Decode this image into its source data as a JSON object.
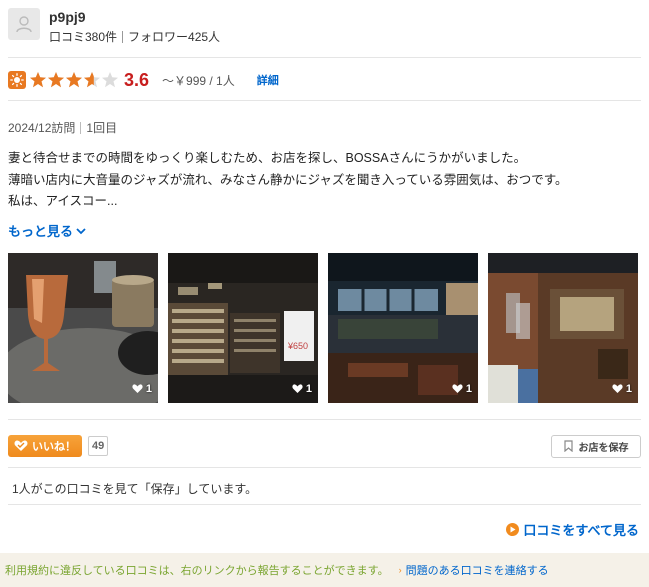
{
  "user": {
    "name": "p9pj9",
    "reviews": "口コミ380件",
    "followers": "フォロワー425人"
  },
  "rating": {
    "score": "3.6",
    "stars_value": 3.6,
    "stars_max": 5,
    "price": "～￥999 / 1人",
    "detail_label": "詳細"
  },
  "visit": {
    "date": "2024/12訪問",
    "count": "1回目"
  },
  "review": {
    "lines": [
      "妻と待合せまでの時間をゆっくり楽しむため、お店を探し、BOSSAさんにうかがいました。",
      "薄暗い店内に大音量のジャズが流れ、みなさん静かにジャズを聞き入っている雰囲気は、おつです。",
      "私は、アイスコー..."
    ],
    "more_label": "もっと見る"
  },
  "photos": [
    {
      "likes": "1",
      "icon": "copper-cup-photo"
    },
    {
      "likes": "1",
      "icon": "record-shelf-photo"
    },
    {
      "likes": "1",
      "icon": "dim-interior-photo"
    },
    {
      "likes": "1",
      "icon": "wall-posters-photo"
    }
  ],
  "actions": {
    "like_label": "いいね！",
    "like_count": "49",
    "save_label": "お店を保存"
  },
  "saved_note": "1人がこの口コミを見て「保存」しています。",
  "all_reviews_label": "口コミをすべて見る",
  "footer": {
    "note": "利用規約に違反している口コミは、右のリンクから報告することができます。",
    "report_label": "問題のある口コミを連絡する"
  },
  "colors": {
    "accent_orange": "#e87922",
    "score_red": "#c81e1e",
    "link_blue": "#0066cc",
    "footer_green": "#7aa530"
  }
}
